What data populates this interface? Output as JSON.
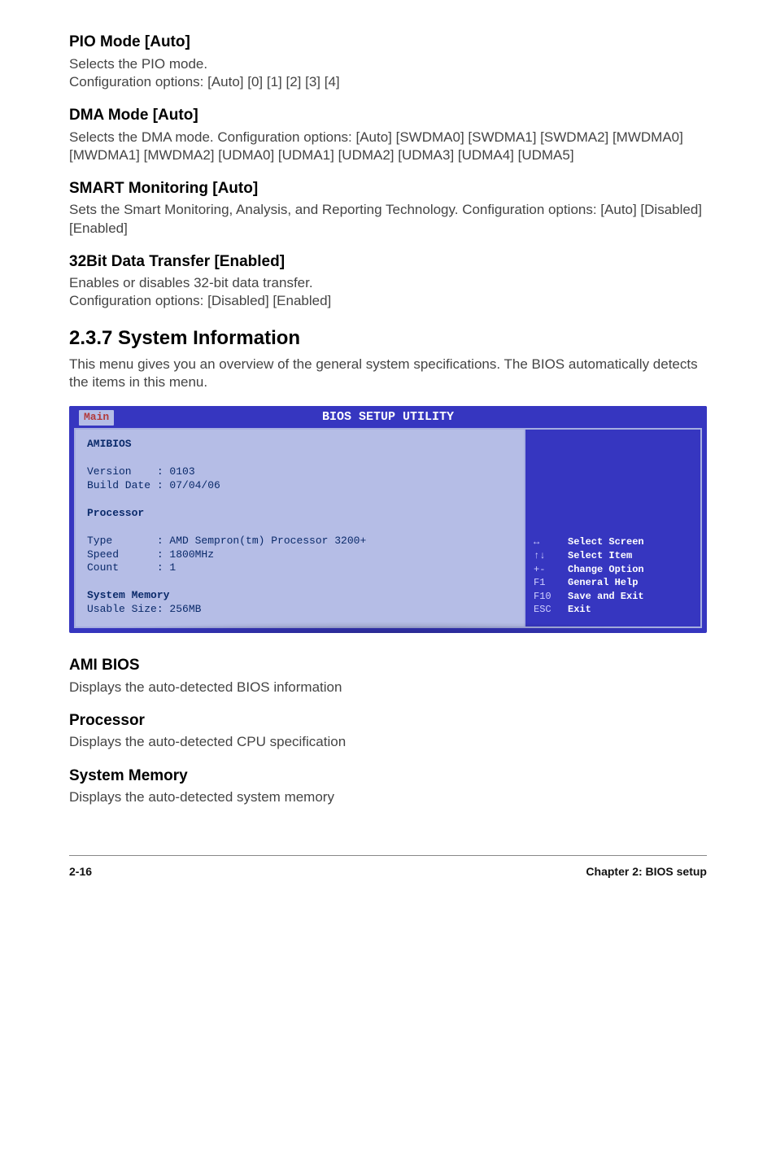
{
  "pio": {
    "heading": "PIO Mode [Auto]",
    "line1": "Selects the PIO mode.",
    "line2": "Configuration options: [Auto] [0] [1] [2] [3] [4]"
  },
  "dma": {
    "heading": "DMA Mode [Auto]",
    "line1": "Selects the DMA mode. Configuration options: [Auto] [SWDMA0] [SWDMA1] [SWDMA2] [MWDMA0] [MWDMA1] [MWDMA2] [UDMA0] [UDMA1] [UDMA2] [UDMA3] [UDMA4] [UDMA5]"
  },
  "smart": {
    "heading": "SMART Monitoring [Auto]",
    "line1": "Sets the Smart Monitoring, Analysis, and Reporting Technology. Configuration options: [Auto] [Disabled] [Enabled]"
  },
  "bit32": {
    "heading": "32Bit Data Transfer [Enabled]",
    "line1": "Enables or disables 32-bit data transfer.",
    "line2": "Configuration options: [Disabled] [Enabled]"
  },
  "sysinfo": {
    "heading": "2.3.7   System Information",
    "line1": "This menu gives you an overview of the general system specifications. The BIOS automatically detects the items in this menu."
  },
  "bios": {
    "title": "BIOS SETUP UTILITY",
    "tab": "Main",
    "left": {
      "amibios": "AMIBIOS",
      "version": "Version    : 0103",
      "build": "Build Date : 07/04/06",
      "processor": "Processor",
      "type": "Type       : AMD Sempron(tm) Processor 3200+",
      "speed": "Speed      : 1800MHz",
      "count": "Count      : 1",
      "sysmem": "System Memory",
      "usable": "Usable Size: 256MB"
    },
    "help": [
      {
        "key": "↔",
        "txt": "Select Screen"
      },
      {
        "key": "↑↓",
        "txt": "Select Item"
      },
      {
        "key": "+-",
        "txt": "Change Option"
      },
      {
        "key": "F1",
        "txt": "General Help"
      },
      {
        "key": "F10",
        "txt": "Save and Exit"
      },
      {
        "key": "ESC",
        "txt": "Exit"
      }
    ]
  },
  "amibios": {
    "heading": "AMI BIOS",
    "line1": "Displays the auto-detected BIOS information"
  },
  "processor": {
    "heading": "Processor",
    "line1": "Displays the auto-detected CPU specification"
  },
  "sysmem": {
    "heading": "System Memory",
    "line1": "Displays the auto-detected system memory"
  },
  "footer": {
    "left": "2-16",
    "right": "Chapter 2: BIOS setup"
  }
}
